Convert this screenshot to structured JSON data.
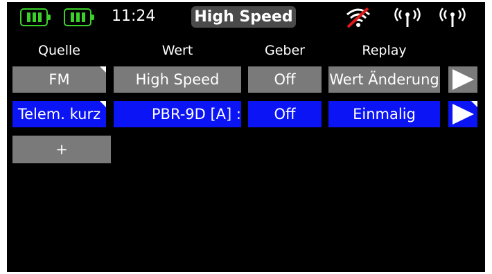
{
  "status": {
    "time": "11:24",
    "title": "High Speed",
    "battery_colors": {
      "battery": "#3ad12a"
    }
  },
  "columns": {
    "quelle": "Quelle",
    "wert": "Wert",
    "geber": "Geber",
    "replay": "Replay"
  },
  "rows": [
    {
      "quelle": "FM",
      "wert": "High Speed",
      "geber": "Off",
      "replay": "Wert Änderung",
      "style": "gray"
    },
    {
      "quelle": "Telem. kurz",
      "wert": "PBR-9D [A] :",
      "geber": "Off",
      "replay": "Einmalig",
      "style": "blue"
    }
  ],
  "add_button": "+",
  "colors": {
    "screen": "#000000",
    "cell_gray": "#7a7a7a",
    "cell_blue": "#0a14f4",
    "accent_green": "#3ad12a"
  },
  "icons": [
    "battery-icon",
    "battery-icon",
    "wifi-off-icon",
    "antenna-signal-icon",
    "antenna-signal-icon",
    "play-icon"
  ]
}
